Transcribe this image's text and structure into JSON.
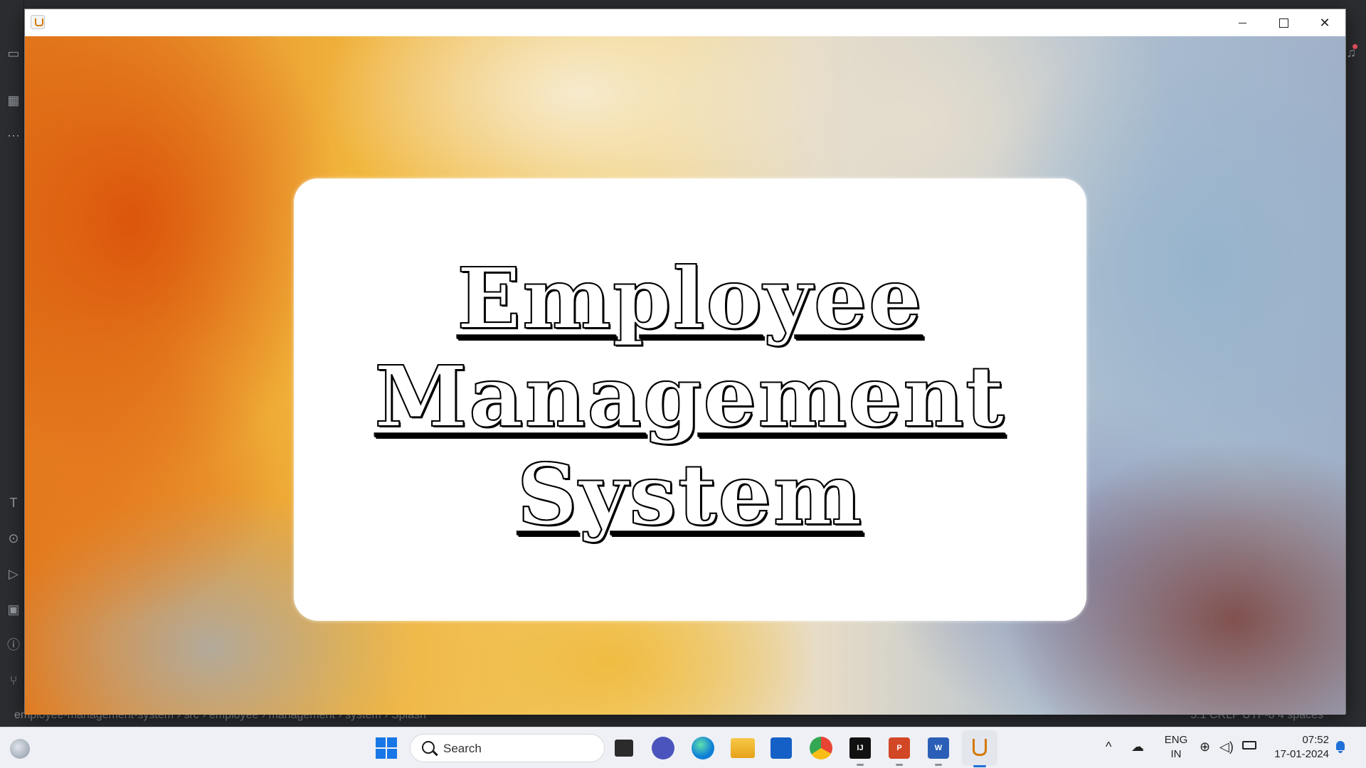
{
  "window": {
    "title_glyph": "",
    "min_glyph": "",
    "max_glyph": "",
    "close_glyph": "✕"
  },
  "splash": {
    "title_lines": [
      "Employee",
      "Management",
      "System"
    ]
  },
  "ide": {
    "breadcrumb": "employee-management-system  ›  src  ›  employee  ›  management  ›  system  ›  Splash",
    "status_right": "5:1   CRLF   UTF-8   4 spaces"
  },
  "taskbar": {
    "search_label": "Search",
    "lang_line1": "ENG",
    "lang_line2": "IN",
    "time": "07:52",
    "date": "17-01-2024",
    "apps": [
      {
        "name": "task-view",
        "color": "#2b2b2b"
      },
      {
        "name": "meet",
        "color": "#4b53bc"
      },
      {
        "name": "edge",
        "color": "#0f7fd6"
      },
      {
        "name": "file-explorer",
        "color": "#f3b61f"
      },
      {
        "name": "store",
        "color": "#1560c6"
      },
      {
        "name": "chrome",
        "color": "#e84335"
      },
      {
        "name": "intellij",
        "color": "#111111"
      },
      {
        "name": "powerpoint",
        "color": "#d24726"
      },
      {
        "name": "word",
        "color": "#2b5fb7"
      },
      {
        "name": "java",
        "color": "#e3e6ed"
      }
    ]
  },
  "colors": {
    "accent": "#1f6fd8",
    "ide_bg": "#2b2d30"
  }
}
